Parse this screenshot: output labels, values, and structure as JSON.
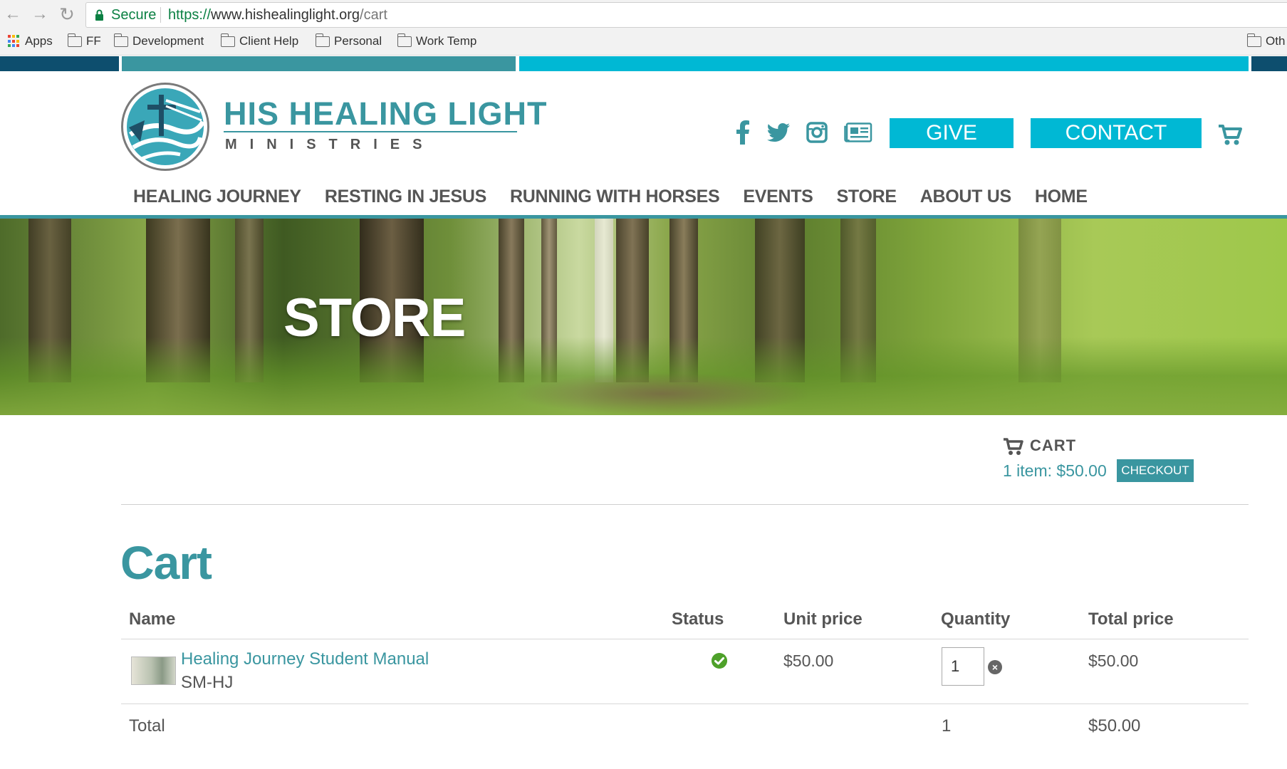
{
  "browser": {
    "secure_label": "Secure",
    "url_scheme": "https://",
    "url_host": "www.hishealinglight.org",
    "url_path": "/cart",
    "bookmarks": [
      {
        "label": "Apps"
      },
      {
        "label": "FF"
      },
      {
        "label": "Development"
      },
      {
        "label": "Client Help"
      },
      {
        "label": "Personal"
      },
      {
        "label": "Work Temp"
      },
      {
        "label": "Oth"
      }
    ]
  },
  "header": {
    "brand_title": "HIS HEALING LIGHT",
    "brand_subtitle": "MINISTRIES",
    "social_icons": [
      "facebook-icon",
      "twitter-icon",
      "instagram-icon",
      "newsletter-icon"
    ],
    "give_label": "GIVE",
    "contact_label": "CONTACT",
    "accent_color": "#00b8d4",
    "brand_color": "#3a96a0"
  },
  "nav": {
    "items": [
      {
        "label": "HEALING JOURNEY"
      },
      {
        "label": "RESTING IN JESUS"
      },
      {
        "label": "RUNNING WITH HORSES"
      },
      {
        "label": "EVENTS"
      },
      {
        "label": "STORE"
      },
      {
        "label": "ABOUT US"
      },
      {
        "label": "HOME"
      }
    ]
  },
  "hero": {
    "title": "STORE"
  },
  "mini_cart": {
    "label": "CART",
    "summary": "1 item: $50.00",
    "checkout_label": "CHECKOUT"
  },
  "cart": {
    "heading": "Cart",
    "columns": {
      "name": "Name",
      "status": "Status",
      "unit_price": "Unit price",
      "quantity": "Quantity",
      "total_price": "Total price"
    },
    "rows": [
      {
        "name": "Healing Journey Student Manual",
        "sku": "SM-HJ",
        "status_icon": "check-circle-icon",
        "unit_price": "$50.00",
        "quantity": "1",
        "total_price": "$50.00"
      }
    ],
    "total": {
      "label": "Total",
      "quantity": "1",
      "price": "$50.00"
    }
  }
}
